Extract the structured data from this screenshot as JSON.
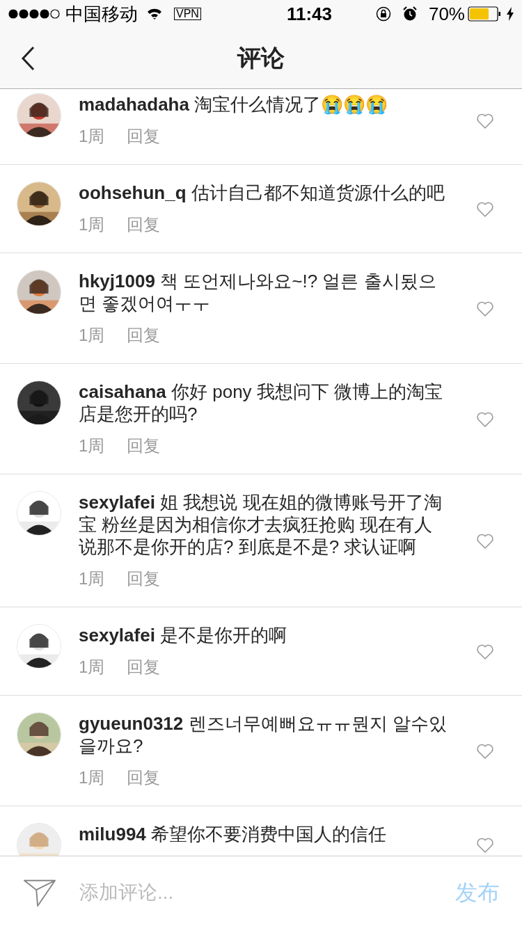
{
  "status_bar": {
    "carrier": "中国移动",
    "vpn": "VPN",
    "time": "11:43",
    "battery": "70%"
  },
  "nav": {
    "title": "评论"
  },
  "comments": [
    {
      "user": "madahadaha",
      "text": "淘宝什么情况了😭😭😭",
      "time": "1周",
      "reply": "回复"
    },
    {
      "user": "oohsehun_q",
      "text": "估计自己都不知道货源什么的吧",
      "time": "1周",
      "reply": "回复"
    },
    {
      "user": "hkyj1009",
      "text": "책 또언제나와요~!? 얼른 출시됬으면 좋겠어여ㅜㅜ",
      "time": "1周",
      "reply": "回复"
    },
    {
      "user": "caisahana",
      "text": "你好 pony 我想问下 微博上的淘宝店是您开的吗?",
      "time": "1周",
      "reply": "回复"
    },
    {
      "user": "sexylafei",
      "text": "姐 我想说 现在姐的微博账号开了淘宝 粉丝是因为相信你才去疯狂抢购 现在有人说那不是你开的店? 到底是不是? 求认证啊",
      "time": "1周",
      "reply": "回复"
    },
    {
      "user": "sexylafei",
      "text": "是不是你开的啊",
      "time": "1周",
      "reply": "回复"
    },
    {
      "user": "gyueun0312",
      "text": "렌즈너무예뻐요ㅠㅠ뭔지 알수있을까요?",
      "time": "1周",
      "reply": "回复"
    },
    {
      "user": "milu994",
      "text": "希望你不要消费中国人的信任"
    }
  ],
  "composer": {
    "placeholder": "添加评论...",
    "submit": "发布"
  }
}
